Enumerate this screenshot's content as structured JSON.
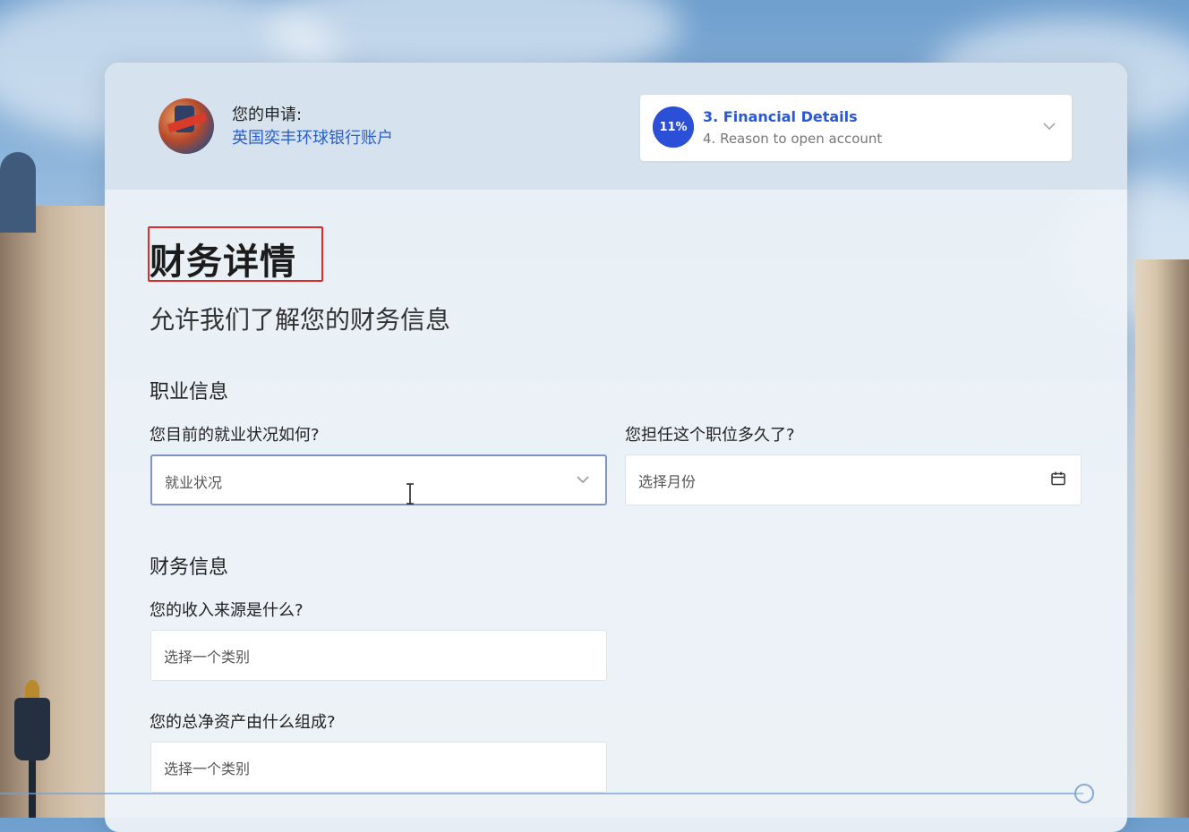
{
  "header": {
    "application_label": "您的申请:",
    "application_name": "英国奕丰环球银行账户"
  },
  "progress": {
    "percent_text": "11%",
    "percent_value": 11,
    "current_step": "3. Financial Details",
    "next_step": "4. Reason to open account"
  },
  "page": {
    "title": "财务详情",
    "subtitle": "允许我们了解您的财务信息"
  },
  "occupation": {
    "section_title": "职业信息",
    "employment_question": "您目前的就业状况如何?",
    "employment_placeholder": "就业状况",
    "duration_question": "您担任这个职位多久了?",
    "duration_placeholder": "选择月份"
  },
  "finance": {
    "section_title": "财务信息",
    "income_question": "您的收入来源是什么?",
    "income_placeholder": "选择一个类别",
    "networth_question": "您的总净资产由什么组成?",
    "networth_placeholder": "选择一个类别"
  },
  "icons": {
    "dropdown": "chevron-down-icon",
    "calendar": "calendar-icon",
    "cursor": "text-cursor-icon"
  },
  "colors": {
    "accent": "#2c4fd8",
    "link": "#2a5fc8",
    "highlight_box": "#e02b2b"
  }
}
